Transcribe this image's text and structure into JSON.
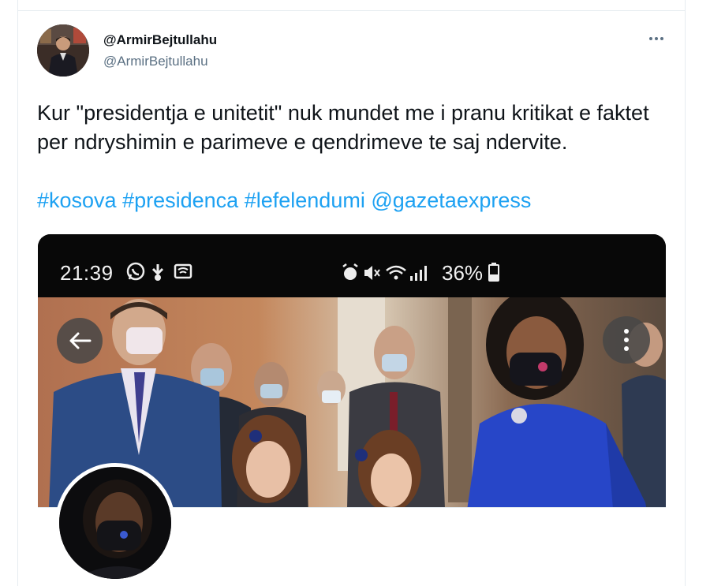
{
  "tweet": {
    "display_name": "@ArmirBejtullahu",
    "handle": "@ArmirBejtullahu",
    "more_label": "More",
    "text": "Kur \"presidentja e unitetit\" nuk mundet me i pranu kritikat e faktet per ndryshimin e parimeve e qendrimeve te saj ndervite.",
    "hashtags": [
      "#kosova",
      "#presidenca",
      "#lefelendumi",
      "@gazetaexpress"
    ]
  },
  "media": {
    "status_bar": {
      "time": "21:39",
      "battery": "36%"
    }
  },
  "colors": {
    "link": "#1da1f2",
    "secondary_text": "#5b7083",
    "dress_blue": "#2746c8"
  },
  "icons": [
    "whatsapp-icon",
    "download-icon",
    "wallet-icon",
    "alarm-icon",
    "mute-icon",
    "wifi-icon",
    "signal-icon",
    "battery-icon",
    "back-arrow-icon",
    "kebab-menu-icon",
    "more-icon"
  ]
}
